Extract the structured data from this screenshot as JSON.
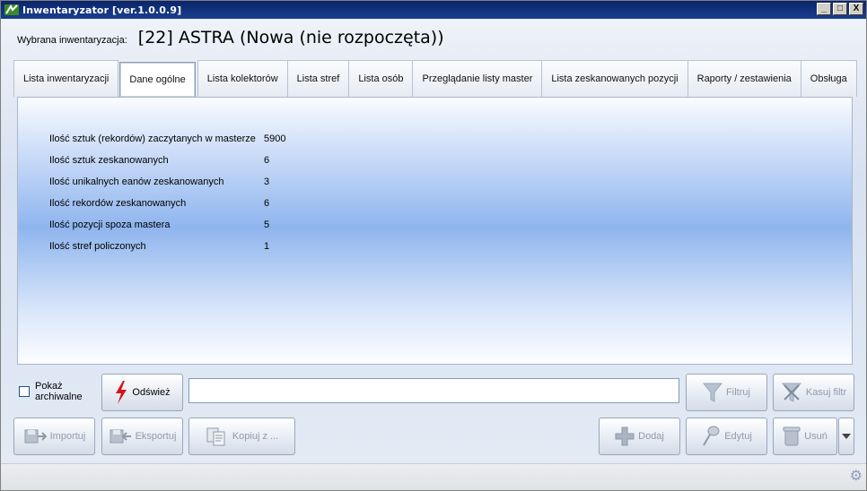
{
  "window": {
    "title": "Inwentaryzator [ver.1.0.0.9]",
    "controls": {
      "minimize": "_",
      "maximize": "□",
      "close": "X"
    }
  },
  "header": {
    "label": "Wybrana inwentaryzacja:",
    "value": "[22] ASTRA (Nowa (nie rozpoczęta))"
  },
  "tabs": [
    {
      "label": "Lista inwentaryzacji"
    },
    {
      "label": "Dane ogólne",
      "active": true
    },
    {
      "label": "Lista kolektorów"
    },
    {
      "label": "Lista stref"
    },
    {
      "label": "Lista osób"
    },
    {
      "label": "Przeglądanie listy master"
    },
    {
      "label": "Lista zeskanowanych pozycji"
    },
    {
      "label": "Raporty / zestawienia"
    },
    {
      "label": "Obsługa"
    }
  ],
  "stats": [
    {
      "label": "Ilość sztuk (rekordów) zaczytanych w masterze",
      "value": "5900"
    },
    {
      "label": "Ilość sztuk zeskanowanych",
      "value": "6"
    },
    {
      "label": "Ilość unikalnych eanów zeskanowanych",
      "value": "3"
    },
    {
      "label": "Ilość rekordów zeskanowanych",
      "value": "6"
    },
    {
      "label": "Ilość pozycji spoza mastera",
      "value": "5"
    },
    {
      "label": "Ilość stref policzonych",
      "value": "1"
    }
  ],
  "toolbar": {
    "show_archived_label": "Pokaż archiwalne",
    "refresh_label": "Odśwież",
    "filter_value": "",
    "filter_label": "Filtruj",
    "clear_filter_label": "Kasuj filtr",
    "import_label": "Importuj",
    "export_label": "Eksportuj",
    "copy_label": "Kopiuj z ...",
    "add_label": "Dodaj",
    "edit_label": "Edytuj",
    "delete_label": "Usuń"
  },
  "colors": {
    "titlebar": "#0a246a",
    "accent_red": "#d7141a",
    "disabled_text": "#8f9aa9"
  }
}
